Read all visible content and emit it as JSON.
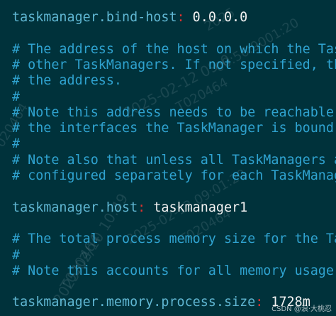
{
  "lines": [
    {
      "type": "kv",
      "key": "taskmanager.bind-host",
      "value": "0.0.0.0"
    },
    {
      "type": "blank"
    },
    {
      "type": "comment",
      "text": "# The address of the host on which the TaskM"
    },
    {
      "type": "comment",
      "text": "# other TaskManagers. If not specified, the"
    },
    {
      "type": "comment",
      "text": "# the address."
    },
    {
      "type": "comment",
      "text": "#"
    },
    {
      "type": "comment",
      "text": "# Note this address needs to be reachable by"
    },
    {
      "type": "comment",
      "text": "# the interfaces the TaskManager is bound to"
    },
    {
      "type": "comment",
      "text": "#"
    },
    {
      "type": "comment",
      "text": "# Note also that unless all TaskManagers are"
    },
    {
      "type": "comment",
      "text": "# configured separately for each TaskManager"
    },
    {
      "type": "blank"
    },
    {
      "type": "kv",
      "key": "taskmanager.host",
      "value": "taskmanager1"
    },
    {
      "type": "blank"
    },
    {
      "type": "comment",
      "text": "# The total process memory size for the Task"
    },
    {
      "type": "comment",
      "text": "#"
    },
    {
      "type": "comment",
      "text": "# Note this accounts for all memory usage wi"
    },
    {
      "type": "blank"
    },
    {
      "type": "kv",
      "key": "taskmanager.memory.process.size",
      "value": "1728m"
    }
  ],
  "colon": ":",
  "watermarks": {
    "w1": "2025-02-12 09:0",
    "w2": "T020464",
    "w3": "020464",
    "w4": "2025-02-12 09:01:20",
    "w5": "T020464",
    "w6": "2025/02/10 10:49",
    "w7": "T020464",
    "w8": "00:56:9001:20",
    "w9": "2025"
  },
  "credit": "CSDN @浪·大桃忍"
}
